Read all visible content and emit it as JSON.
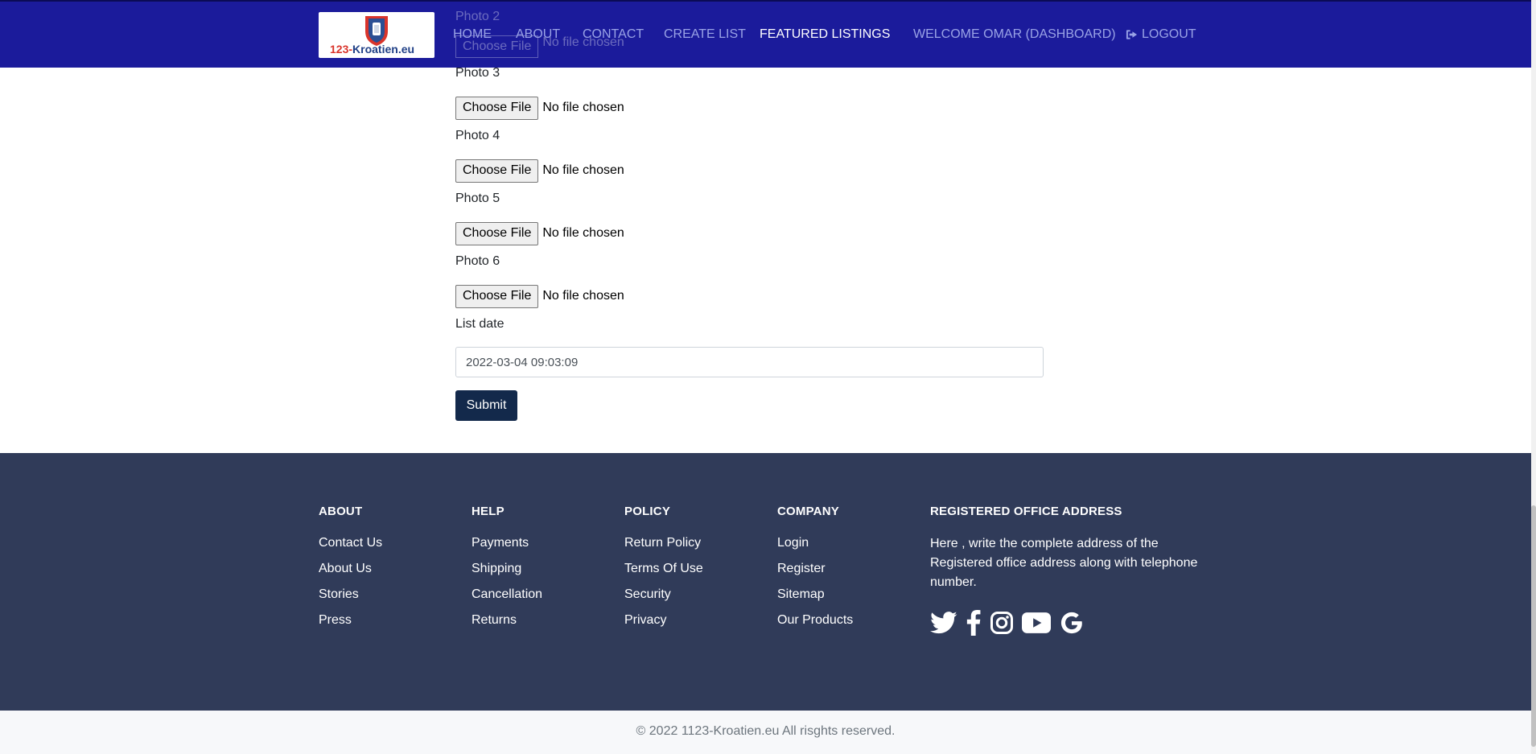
{
  "nav": {
    "logo_text_prefix": "123-",
    "logo_text_main": "Kroatien.eu",
    "links": [
      "HOME",
      "ABOUT",
      "CONTACT",
      "CREATE LIST",
      "FEATURED LISTINGS"
    ],
    "welcome": "WELCOME OMAR (DASHBOARD)",
    "logout": "LOGOUT",
    "logout_icon": "sign-out-icon"
  },
  "form": {
    "partial_label": "Photo 2",
    "photos": [
      {
        "label": "Photo 3",
        "button": "Choose File",
        "status": "No file chosen"
      },
      {
        "label": "Photo 4",
        "button": "Choose File",
        "status": "No file chosen"
      },
      {
        "label": "Photo 5",
        "button": "Choose File",
        "status": "No file chosen"
      },
      {
        "label": "Photo 6",
        "button": "Choose File",
        "status": "No file chosen"
      }
    ],
    "partial_button": "Choose File",
    "partial_status": "No file chosen",
    "list_date_label": "List date",
    "list_date_value": "2022-03-04 09:03:09",
    "submit": "Submit",
    "submit_color": "#13294b"
  },
  "footer": {
    "bg_color": "#303b59",
    "about": {
      "heading": "ABOUT",
      "links": [
        "Contact Us",
        "About Us",
        "Stories",
        "Press"
      ]
    },
    "help": {
      "heading": "HELP",
      "links": [
        "Payments",
        "Shipping",
        "Cancellation",
        "Returns"
      ]
    },
    "policy": {
      "heading": "POLICY",
      "links": [
        "Return Policy",
        "Terms Of Use",
        "Security",
        "Privacy"
      ]
    },
    "company": {
      "heading": "COMPANY",
      "links": [
        "Login",
        "Register",
        "Sitemap",
        "Our Products"
      ]
    },
    "address": {
      "heading": "REGISTERED OFFICE ADDRESS",
      "text": "Here , write the complete address of the Registered office address along with telephone number."
    },
    "social_icons": [
      "twitter-icon",
      "facebook-icon",
      "instagram-icon",
      "youtube-icon",
      "google-icon"
    ]
  },
  "copyright": "© 2022 1123-Kroatien.eu All risghts reserved.",
  "navbar_color": "#1b1b9b"
}
